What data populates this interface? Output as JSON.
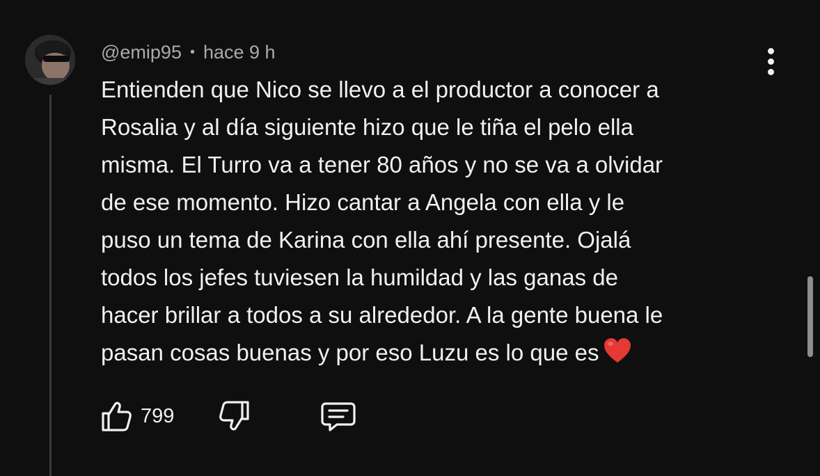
{
  "comment": {
    "author": "@emip95",
    "separator": "•",
    "time": "hace 9 h",
    "lines": [
      "Entienden que Nico se llevo a el productor a conocer a",
      "Rosalia y al día siguiente hizo que le tiña el pelo ella",
      "misma. El Turro va a tener 80 años y no se va a olvidar",
      "de ese momento. Hizo cantar a Angela con ella y le",
      "puso un tema de Karina con ella ahí presente. Ojalá",
      "todos los jefes tuviesen la humildad y las ganas de",
      "hacer brillar a todos a su alrededor. A la gente buena le",
      "pasan cosas buenas y por eso Luzu es lo que es"
    ],
    "emoji": "❤️",
    "likes": "799"
  },
  "icons": {
    "avatar": "avatar-image",
    "menu": "more-vert-icon",
    "like": "thumb-up-icon",
    "dislike": "thumb-down-icon",
    "reply": "comment-reply-icon",
    "heart": "red-heart-icon"
  },
  "colors": {
    "background": "#0f0f0f",
    "text": "#f1f1f1",
    "meta": "#aaaaaa",
    "heart": "#e53935"
  }
}
